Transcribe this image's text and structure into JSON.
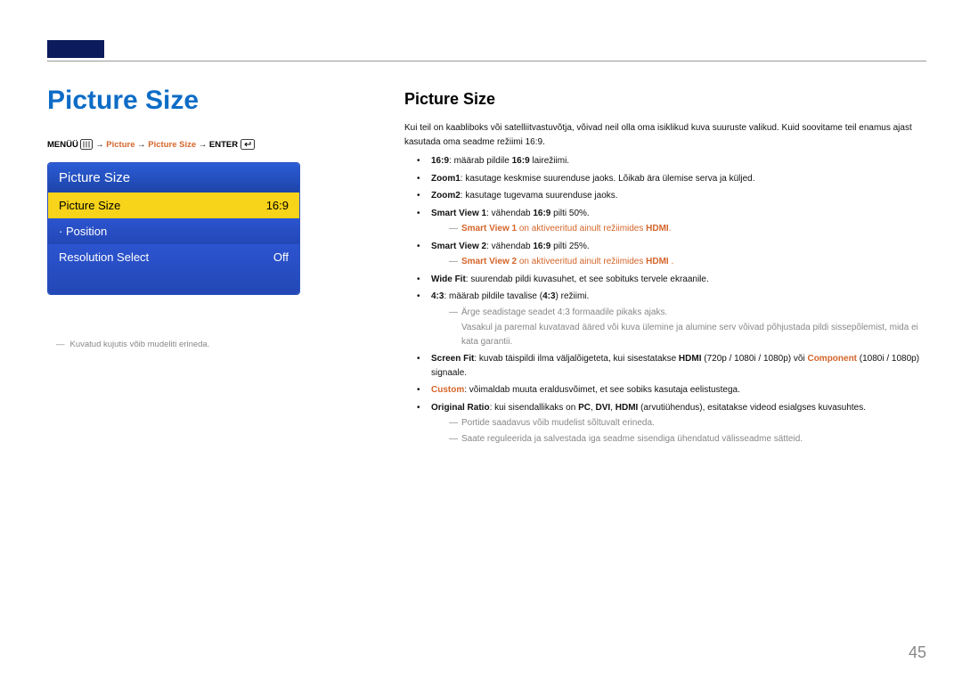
{
  "page_number": "45",
  "titles": {
    "left": "Picture Size",
    "right": "Picture Size"
  },
  "breadcrumb": {
    "menu": "MENÜÜ",
    "arrow1": "→",
    "picture": "Picture",
    "picture_size": "Picture Size",
    "enter": "ENTER"
  },
  "osd": {
    "title": "Picture Size",
    "rows": [
      {
        "label": "Picture Size",
        "value": "16:9",
        "selected": true
      },
      {
        "label": "Position",
        "value": "",
        "selected": false,
        "dot": true
      },
      {
        "label": "Resolution Select",
        "value": "Off",
        "selected": false
      }
    ]
  },
  "note_under": "Kuvatud kujutis võib mudeliti erineda.",
  "intro": "Kui teil on kaabliboks või satelliitvastuvõtja, võivad neil olla oma isiklikud kuva suuruste valikud. Kuid soovitame teil enamus ajast kasutada oma seadme režiimi 16:9.",
  "bullets": {
    "b1_a": "16:9",
    "b1_b": ": määrab pildile ",
    "b1_c": "16:9",
    "b1_d": " lairežiimi.",
    "b2_a": "Zoom1",
    "b2_b": ": kasutage keskmise suurenduse jaoks. Lõikab ära ülemise serva ja küljed.",
    "b3_a": "Zoom2",
    "b3_b": ": kasutage tugevama suurenduse jaoks.",
    "b4_a": "Smart View 1",
    "b4_b": ": vähendab ",
    "b4_c": "16:9",
    "b4_d": " pilti 50%.",
    "b4_sub_a": "Smart View 1",
    "b4_sub_b": " on aktiveeritud ainult režiimides ",
    "b4_sub_c": "HDMI",
    "b4_sub_dot": ".",
    "b5_a": "Smart View 2",
    "b5_b": ": vähendab ",
    "b5_c": "16:9",
    "b5_d": " pilti 25%.",
    "b5_sub_a": "Smart View 2",
    "b5_sub_b": " on aktiveeritud ainult režiimides ",
    "b5_sub_c": "HDMI",
    "b5_sub_d": " .",
    "b6_a": "Wide Fit",
    "b6_b": ": suurendab pildi kuvasuhet, et see sobituks tervele ekraanile.",
    "b7_a": "4:3",
    "b7_b": ": määrab pildile tavalise (",
    "b7_c": "4:3",
    "b7_d": ") režiimi.",
    "b7_sub1": "Ärge seadistage seadet 4:3 formaadile pikaks ajaks.",
    "b7_sub2": "Vasakul ja paremal kuvatavad ääred või kuva ülemine ja alumine serv võivad põhjustada pildi sissepõlemist, mida ei kata garantii.",
    "b8_a": "Screen Fit",
    "b8_b": ": kuvab täispildi ilma väljalõigeteta, kui sisestatakse ",
    "b8_c": "HDMI",
    "b8_d": " (720p / 1080i / 1080p) või ",
    "b8_e": "Component",
    "b8_f": " (1080i / 1080p) signaale.",
    "b9_a": "Custom",
    "b9_b": ": võimaldab muuta eraldusvõimet, et see sobiks kasutaja eelistustega.",
    "b10_a": "Original Ratio",
    "b10_b": ": kui sisendallikaks on ",
    "b10_c": "PC",
    "b10_d": ", ",
    "b10_e": "DVI",
    "b10_f": ", ",
    "b10_g": "HDMI",
    "b10_h": " (arvutiühendus), esitatakse videod esialgses kuvasuhtes.",
    "tail1": "Portide saadavus võib mudelist sõltuvalt erineda.",
    "tail2": "Saate reguleerida ja salvestada iga seadme sisendiga ühendatud välisseadme sätteid."
  }
}
